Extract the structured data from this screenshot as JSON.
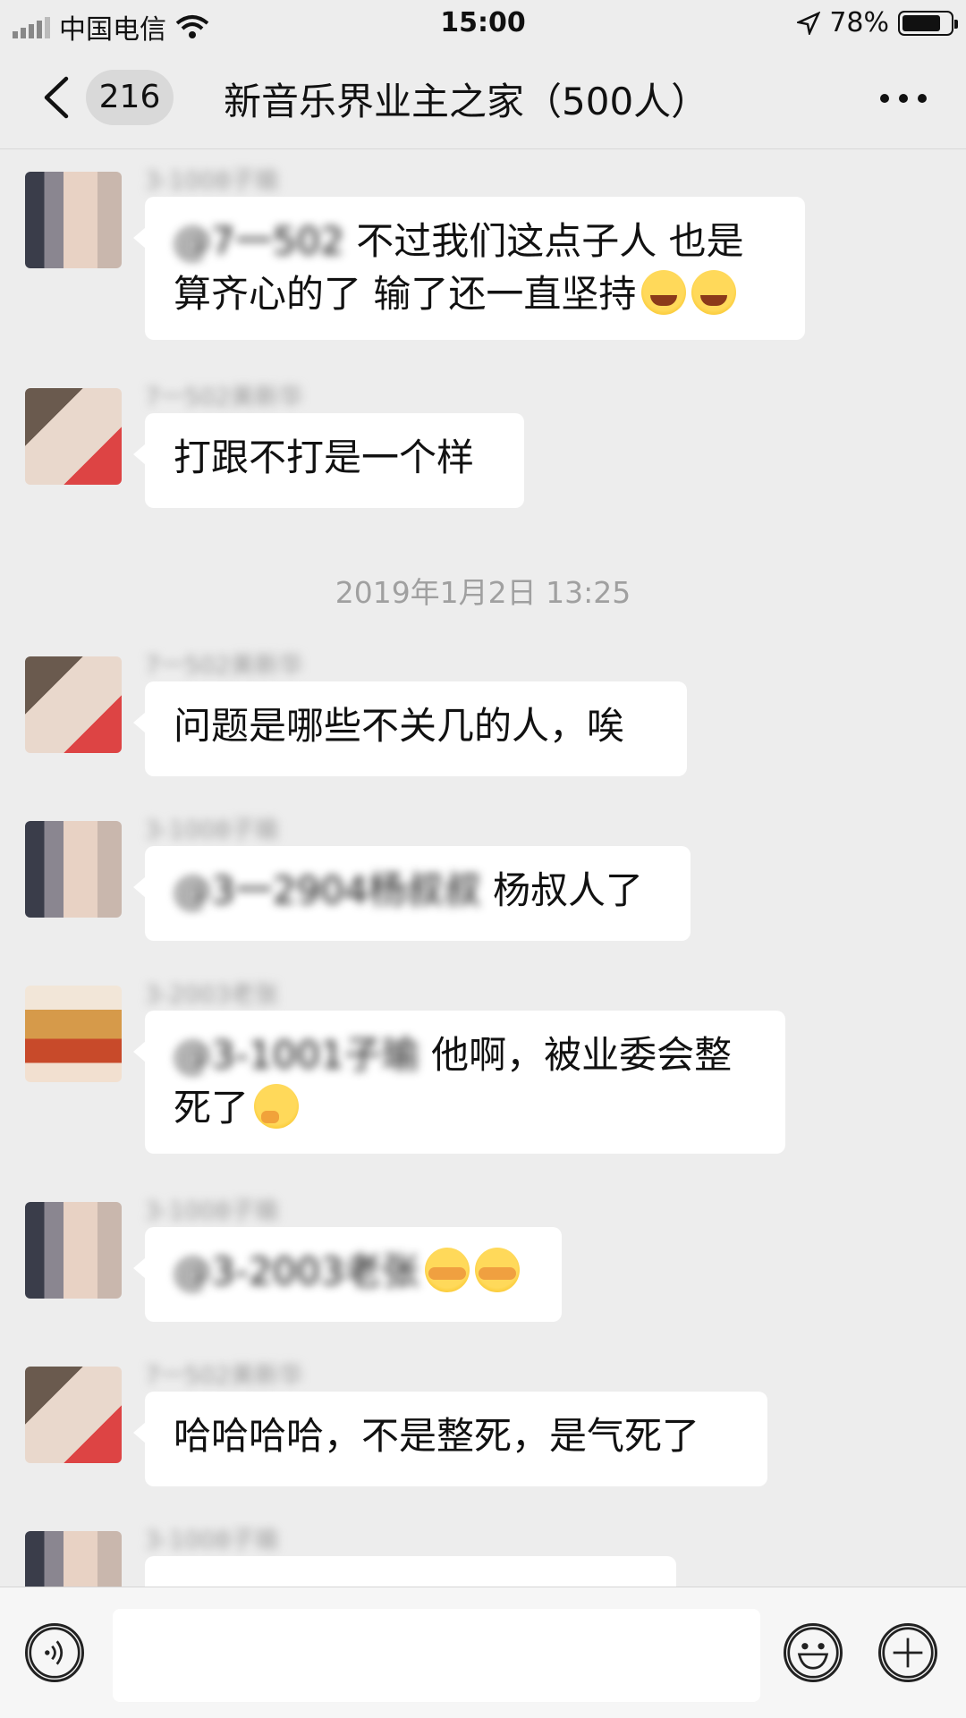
{
  "status_bar": {
    "carrier": "中国电信",
    "time": "15:00",
    "battery": "78%"
  },
  "nav": {
    "unread_count": "216",
    "title": "新音乐界业主之家（500人）"
  },
  "timestamp": "2019年1月2日 13:25",
  "messages": [
    {
      "sender": "3-1008子瑜",
      "mention": "@7一502",
      "text": "不过我们这点子人 也是算齐心的了 输了还一直坚持",
      "emojis": [
        "laugh-crying-emoji",
        "laugh-crying-emoji"
      ]
    },
    {
      "sender": "7一502美新华",
      "text": "打跟不打是一个样"
    },
    {
      "sender": "7一502美新华",
      "text": "问题是哪些不关几的人，唉"
    },
    {
      "sender": "3-1008子瑜",
      "mention": "@3一2904杨叔叔",
      "text": "杨叔人了"
    },
    {
      "sender": "3-2003老张",
      "mention": "@3-1001子瑜",
      "text": "他啊，被业委会整死了",
      "emojis": [
        "thinking-emoji"
      ]
    },
    {
      "sender": "3-1008子瑜",
      "mention": "@3-2003老张",
      "text": "",
      "emojis": [
        "facepalm-emoji",
        "facepalm-emoji"
      ]
    },
    {
      "sender": "7一502美新华",
      "text": "哈哈哈哈，不是整死，是气死了"
    },
    {
      "sender": "3-1008子瑜",
      "text": ""
    }
  ]
}
